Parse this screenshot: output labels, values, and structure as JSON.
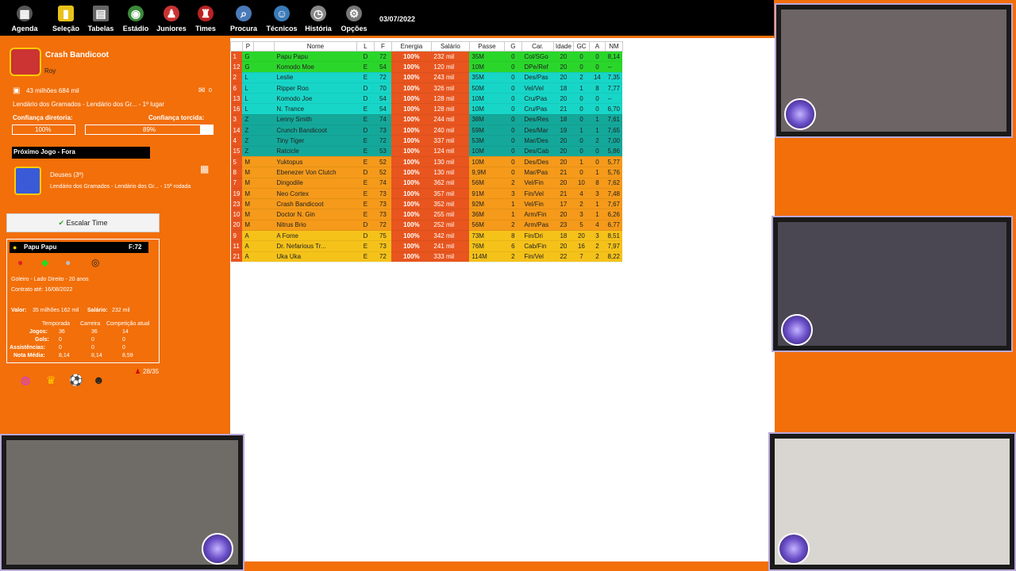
{
  "topbar": {
    "items": [
      "Agenda",
      "Seleção",
      "Tabelas",
      "Estádio",
      "Juniores",
      "Times",
      "Procura",
      "Técnicos",
      "História",
      "Opções"
    ],
    "date": "03/07/2022"
  },
  "team": {
    "name": "Crash Bandicoot",
    "manager": "Roy",
    "money": "43 milhões 684 mil",
    "mail_count": "0",
    "league": "Lendário dos Gramados - Lendário dos Gr... - 1º lugar",
    "board_label": "Confiança diretoria:",
    "board_value": "100%",
    "fans_label": "Confiança torcida:",
    "fans_value": "89%"
  },
  "next_match": {
    "title": "Próximo Jogo - Fora",
    "opponent": "Deuses (3º)",
    "competition": "Lendário dos Gramados - Lendário dos Gr... - 15ª rodada"
  },
  "escalar_button": "Escalar Time",
  "player": {
    "name": "Papu Papu",
    "rating": "F:72",
    "desc": "Goleiro - Lado Direito - 20 anos",
    "contract": "Contrato até: 16/08/2022",
    "valor_label": "Valor:",
    "valor": "35 milhões 162 mil",
    "salario_label": "Salário:",
    "salario": "232 mil",
    "col_headers": [
      "Temporada",
      "Carreira",
      "Competição atual"
    ],
    "rows": [
      {
        "label": "Jogos:",
        "vals": [
          "36",
          "36",
          "14"
        ]
      },
      {
        "label": "Gols:",
        "vals": [
          "0",
          "0",
          "0"
        ]
      },
      {
        "label": "Assistências:",
        "vals": [
          "0",
          "0",
          "0"
        ]
      },
      {
        "label": "Nota Média:",
        "vals": [
          "8,14",
          "8,14",
          "8,59"
        ]
      }
    ]
  },
  "squad_count": "28/35",
  "table": {
    "headers": [
      "",
      "P",
      "",
      "Nome",
      "L",
      "F",
      "Energia",
      "Salário",
      "Passe",
      "G",
      "Car.",
      "Idade",
      "GC",
      "A",
      "NM"
    ],
    "rows": [
      [
        "1",
        "G",
        "Papu Papu",
        "D",
        "72",
        "100%",
        "232 mil",
        "35M",
        "0",
        "Col/SGo",
        "20",
        "0",
        "0",
        "8,14",
        "#2bd62b"
      ],
      [
        "12",
        "G",
        "Komodo Moe",
        "E",
        "54",
        "100%",
        "120 mil",
        "10M",
        "0",
        "DPe/Ref",
        "20",
        "0",
        "0",
        "--",
        "#2bd62b"
      ],
      [
        "2",
        "L",
        "Leslie",
        "E",
        "72",
        "100%",
        "243 mil",
        "35M",
        "0",
        "Des/Pas",
        "20",
        "2",
        "14",
        "7,35",
        "#17d6c8"
      ],
      [
        "6",
        "L",
        "Ripper Roo",
        "D",
        "70",
        "100%",
        "326 mil",
        "50M",
        "0",
        "Vel/Vel",
        "18",
        "1",
        "8",
        "7,77",
        "#17d6c8"
      ],
      [
        "13",
        "L",
        "Komodo Joe",
        "D",
        "54",
        "100%",
        "128 mil",
        "10M",
        "0",
        "Cru/Pas",
        "20",
        "0",
        "0",
        "--",
        "#17d6c8"
      ],
      [
        "16",
        "L",
        "N. Trance",
        "E",
        "54",
        "100%",
        "128 mil",
        "10M",
        "0",
        "Cru/Pas",
        "21",
        "0",
        "0",
        "6,70",
        "#17d6c8"
      ],
      [
        "3",
        "Z",
        "Lenny Smith",
        "E",
        "74",
        "100%",
        "244 mil",
        "38M",
        "0",
        "Des/Res",
        "18",
        "0",
        "1",
        "7,61",
        "#14a89a"
      ],
      [
        "14",
        "Z",
        "Crunch Bandicoot",
        "D",
        "73",
        "100%",
        "240 mil",
        "59M",
        "0",
        "Des/Mar",
        "19",
        "1",
        "1",
        "7,65",
        "#14a89a"
      ],
      [
        "4",
        "Z",
        "Tiny Tiger",
        "E",
        "72",
        "100%",
        "337 mil",
        "53M",
        "0",
        "Mar/Des",
        "20",
        "0",
        "2",
        "7,00",
        "#14a89a"
      ],
      [
        "15",
        "Z",
        "Ratcicle",
        "E",
        "53",
        "100%",
        "124 mil",
        "10M",
        "0",
        "Des/Cab",
        "20",
        "0",
        "0",
        "5,86",
        "#14a89a"
      ],
      [
        "5",
        "M",
        "Yuktopus",
        "E",
        "52",
        "100%",
        "130 mil",
        "10M",
        "0",
        "Des/Des",
        "20",
        "1",
        "0",
        "5,77",
        "#f59a1a"
      ],
      [
        "8",
        "M",
        "Ebenezer Von Clutch",
        "D",
        "52",
        "100%",
        "130 mil",
        "9,9M",
        "0",
        "Mar/Pas",
        "21",
        "0",
        "1",
        "5,76",
        "#f59a1a"
      ],
      [
        "7",
        "M",
        "Dingodile",
        "E",
        "74",
        "100%",
        "362 mil",
        "56M",
        "2",
        "Vel/Fin",
        "20",
        "10",
        "8",
        "7,62",
        "#f59a1a"
      ],
      [
        "19",
        "M",
        "Neo Cortex",
        "E",
        "73",
        "100%",
        "357 mil",
        "91M",
        "3",
        "Fin/Vel",
        "21",
        "4",
        "3",
        "7,48",
        "#f59a1a"
      ],
      [
        "23",
        "M",
        "Crash Bandicoot",
        "E",
        "73",
        "100%",
        "352 mil",
        "92M",
        "1",
        "Vel/Fin",
        "17",
        "2",
        "1",
        "7,67",
        "#f59a1a"
      ],
      [
        "10",
        "M",
        "Doctor N. Gin",
        "E",
        "73",
        "100%",
        "255 mil",
        "36M",
        "1",
        "Arm/Fin",
        "20",
        "3",
        "1",
        "6,26",
        "#f59a1a"
      ],
      [
        "20",
        "M",
        "Nitrus Brio",
        "D",
        "72",
        "100%",
        "252 mil",
        "56M",
        "2",
        "Arm/Pas",
        "23",
        "5",
        "4",
        "6,77",
        "#f59a1a"
      ],
      [
        "9",
        "A",
        "A Fome",
        "D",
        "75",
        "100%",
        "342 mil",
        "73M",
        "8",
        "Fin/Dri",
        "18",
        "20",
        "3",
        "8,51",
        "#f5c21a"
      ],
      [
        "11",
        "A",
        "Dr. Nefarious Tr...",
        "E",
        "73",
        "100%",
        "241 mil",
        "76M",
        "6",
        "Cab/Fin",
        "20",
        "16",
        "2",
        "7,97",
        "#f5c21a"
      ],
      [
        "21",
        "A",
        "Uka Uka",
        "E",
        "72",
        "100%",
        "333 mil",
        "114M",
        "2",
        "Fin/Vel",
        "22",
        "7",
        "2",
        "8,22",
        "#f5c21a"
      ]
    ]
  }
}
